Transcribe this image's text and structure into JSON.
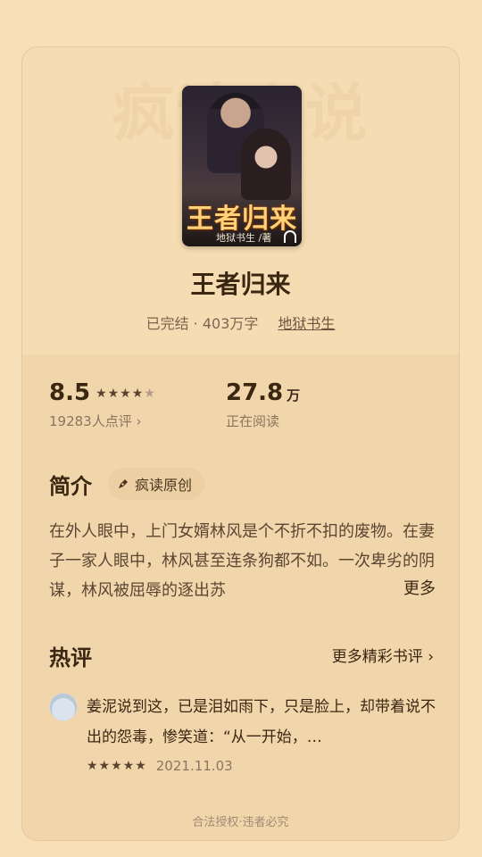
{
  "watermark": "疯读小说",
  "cover": {
    "title": "王者归来",
    "author_line": "地狱书生 /著",
    "badge_icon": "headphone-icon"
  },
  "book": {
    "title": "王者归来",
    "status": "已完结 · 403万字",
    "author": "地狱书生"
  },
  "stats": {
    "score": "8.5",
    "stars": "★★★★",
    "half_star": "★",
    "rating_count": "19283人点评 ›",
    "readers": "27.8",
    "readers_unit": "万",
    "readers_label": "正在阅读"
  },
  "intro": {
    "title": "简介",
    "tag": "疯读原创",
    "text": "在外人眼中，上门女婿林风是个不折不扣的废物。在妻子一家人眼中，林风甚至连条狗都不如。一次卑劣的阴谋，林风被屈辱的逐出苏",
    "more": "更多"
  },
  "hot": {
    "title": "热评",
    "more": "更多精彩书评 ›",
    "review": {
      "text": "姜泥说到这，已是泪如雨下，只是脸上，却带着说不出的怨毒，惨笑道：“从一开始，…",
      "stars": "★★★★★",
      "date": "2021.11.03"
    }
  },
  "footer": "合法授权·违者必究"
}
